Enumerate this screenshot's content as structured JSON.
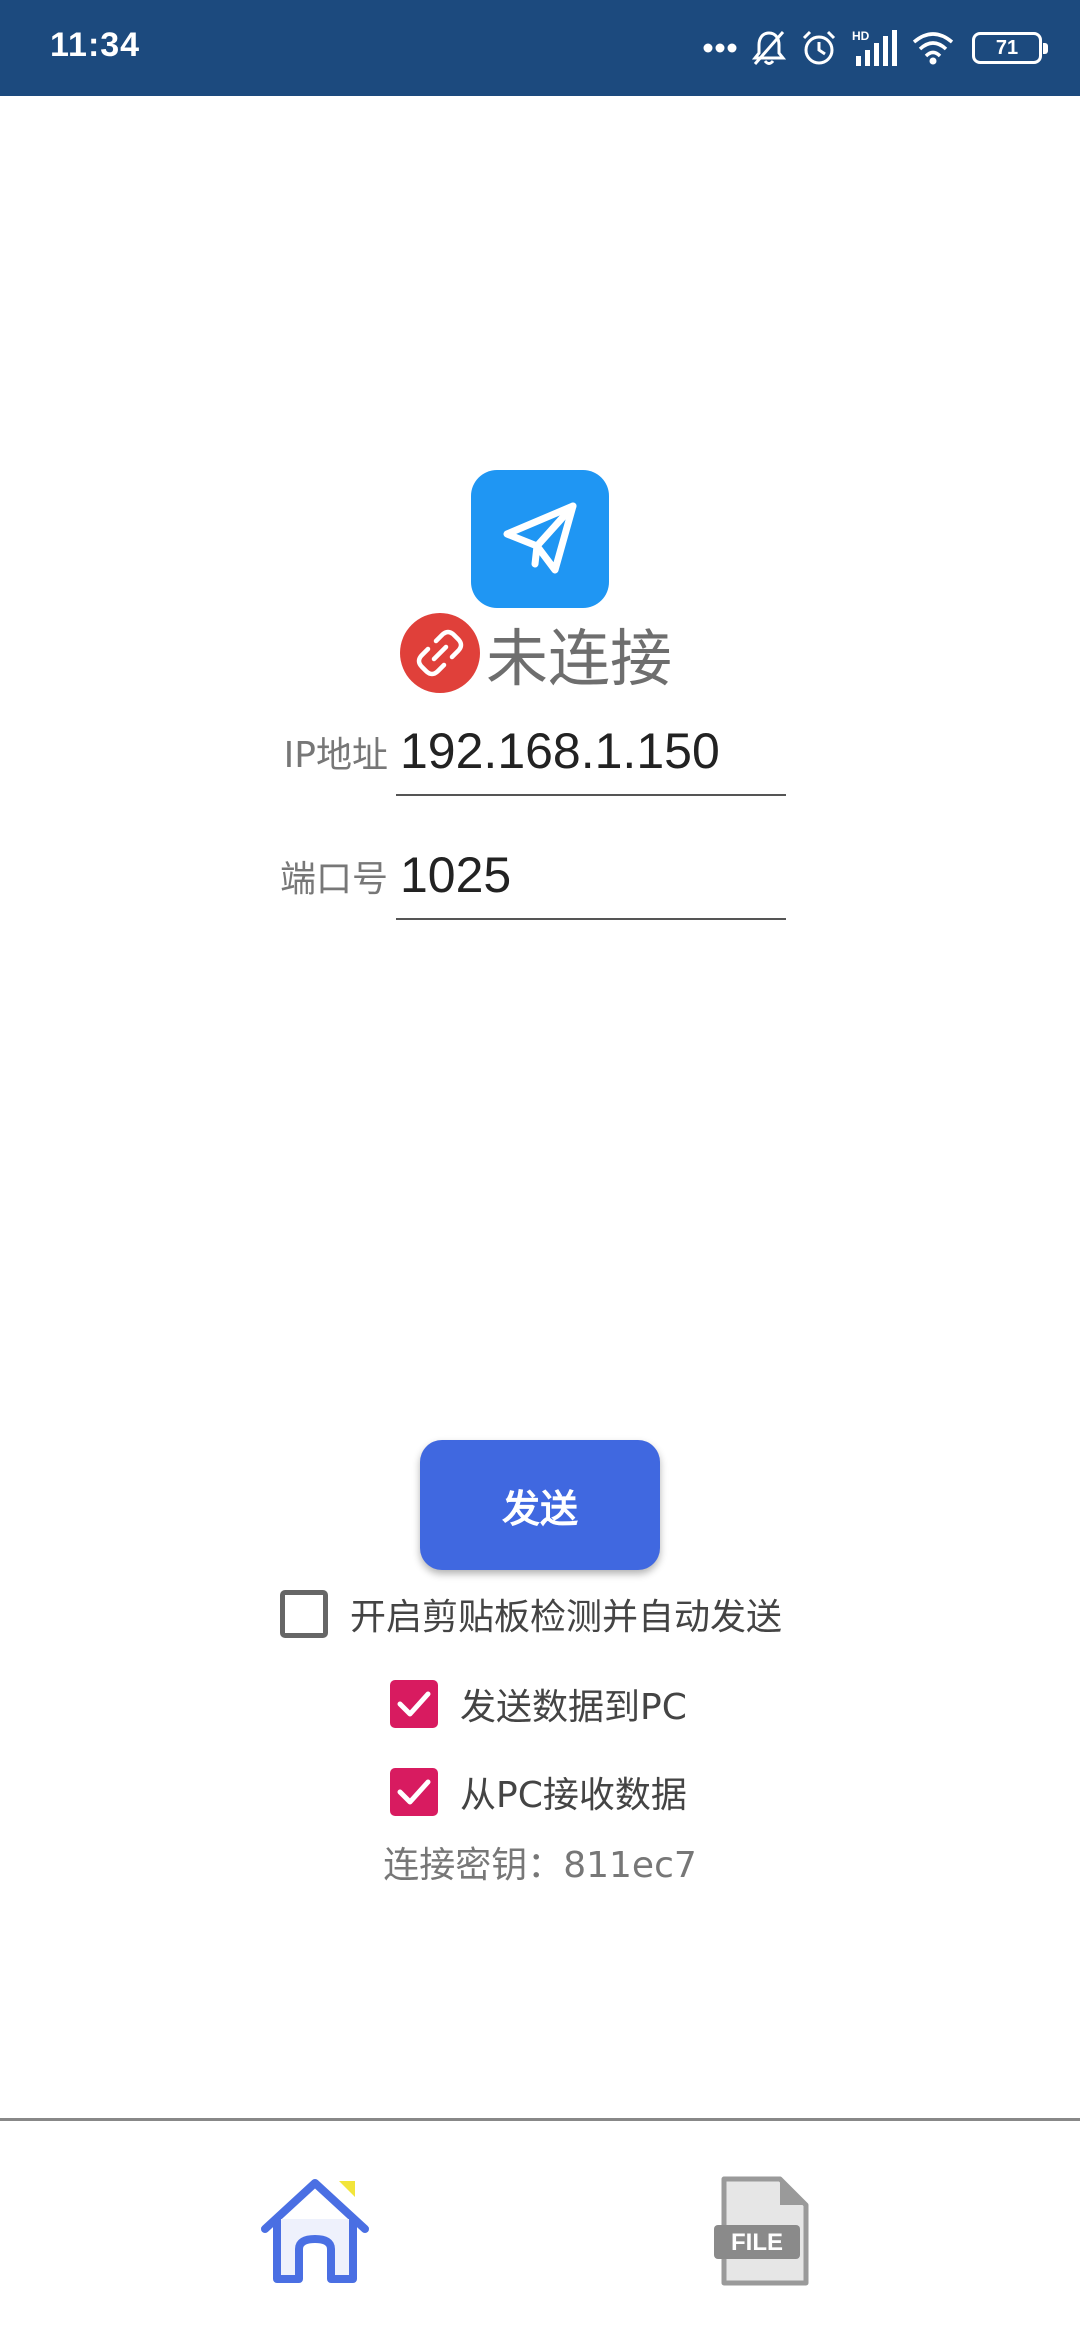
{
  "status_bar": {
    "time": "11:34",
    "icons": [
      "more-dots-icon",
      "bell-off-icon",
      "alarm-icon",
      "hd-signal-icon",
      "wifi-icon",
      "battery-icon"
    ],
    "hd_text": "HD",
    "battery_level": "71"
  },
  "app": {
    "logo_icon": "paper-plane-icon",
    "connection_status": "未连接",
    "connection_status_icon": "unlinked-icon"
  },
  "form": {
    "ip_label": "IP地址",
    "ip_value": "192.168.1.150",
    "port_label": "端口号",
    "port_value": "1025"
  },
  "send_button": "发送",
  "options": [
    {
      "label": "开启剪贴板检测并自动发送",
      "checked": false
    },
    {
      "label": "发送数据到PC",
      "checked": true
    },
    {
      "label": "从PC接收数据",
      "checked": true
    }
  ],
  "connection_key": "连接密钥：811ec7",
  "bottom_nav": {
    "items": [
      {
        "icon": "home-icon",
        "active": true
      },
      {
        "icon": "file-icon",
        "label": "FILE",
        "active": false
      }
    ]
  },
  "colors": {
    "status_bar": "#1c4a7e",
    "logo_bg": "#1f96f3",
    "unlinked_bg": "#e0403a",
    "send_button": "#4068e0",
    "checkbox_checked": "#d81b60"
  }
}
